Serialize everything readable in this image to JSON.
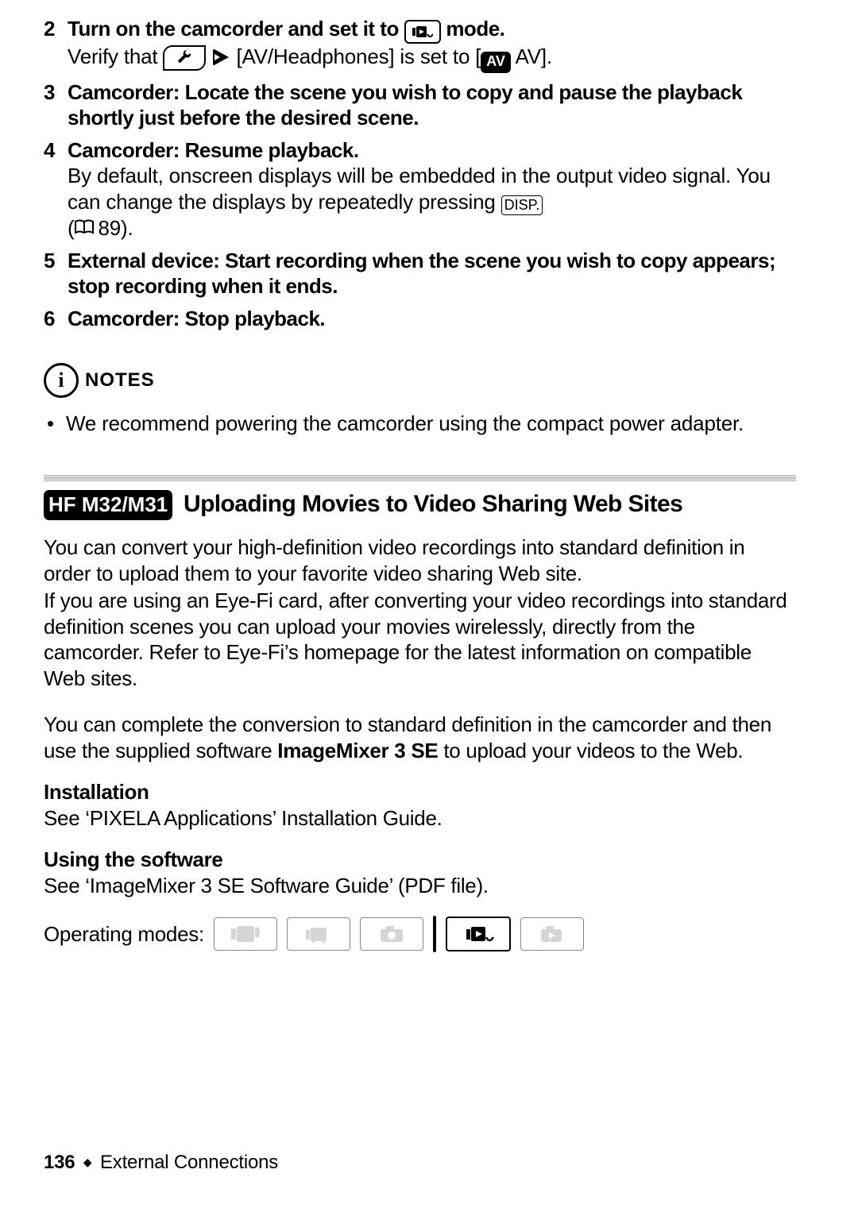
{
  "steps": [
    {
      "num": "2",
      "head_before": "Turn on the camcorder and set it to ",
      "head_after": " mode.",
      "mode_icon": "playback-mode",
      "desc_before": "Verify that ",
      "desc_mid_icon1": "wrench-menu-icon",
      "desc_mid_icon2": "navigate-arrow-icon",
      "desc_mid": " [AV/Headphones] is set to [",
      "desc_mid_badge": "AV",
      "desc_after": " AV]."
    },
    {
      "num": "3",
      "head": "Camcorder: Locate the scene you wish to copy and pause the playback shortly just before the desired scene."
    },
    {
      "num": "4",
      "head": "Camcorder: Resume playback.",
      "desc_before": "By default, onscreen displays will be embedded in the output video signal. You can change the displays by repeatedly pressing ",
      "disp_label": "DISP.",
      "ref_open": "(",
      "ref_page": "89",
      "ref_close": ")."
    },
    {
      "num": "5",
      "head": "External device: Start recording when the scene you wish to copy appears; stop recording when it ends."
    },
    {
      "num": "6",
      "head": "Camcorder: Stop playback."
    }
  ],
  "notes": {
    "label": "NOTES",
    "items": [
      "We recommend powering the camcorder using the compact power adapter."
    ]
  },
  "section": {
    "model_badge": "HF M32/M31",
    "title": "Uploading Movies to Video Sharing Web Sites",
    "p1": "You can convert your high-definition video recordings into standard definition in order to upload them to your favorite video sharing Web site.",
    "p2": "If you are using an Eye-Fi card, after converting your video recordings into standard definition scenes you can upload your movies wirelessly, directly from the camcorder. Refer to Eye-Fi’s homepage for the latest information on compatible Web sites.",
    "p3_before": "You can complete the conversion to standard definition in the camcorder and then use the supplied software ",
    "p3_sw": "ImageMixer 3 SE",
    "p3_after": " to upload your videos to the Web.",
    "install_head": "Installation",
    "install_body": "See ‘PIXELA Applications’ Installation Guide.",
    "use_head": "Using the software",
    "use_body": "See ‘ImageMixer 3 SE Software Guide’ (PDF file).",
    "opmodes_label": "Operating modes:",
    "modes": [
      {
        "name": "auto-mode-icon",
        "on": false
      },
      {
        "name": "manual-record-mode-icon",
        "on": false
      },
      {
        "name": "photo-mode-icon",
        "on": false
      }
    ],
    "modes_right": [
      {
        "name": "movie-playback-mode-icon",
        "on": true
      },
      {
        "name": "photo-playback-mode-icon",
        "on": false
      }
    ]
  },
  "footer": {
    "page": "136",
    "chapter": "External Connections"
  }
}
